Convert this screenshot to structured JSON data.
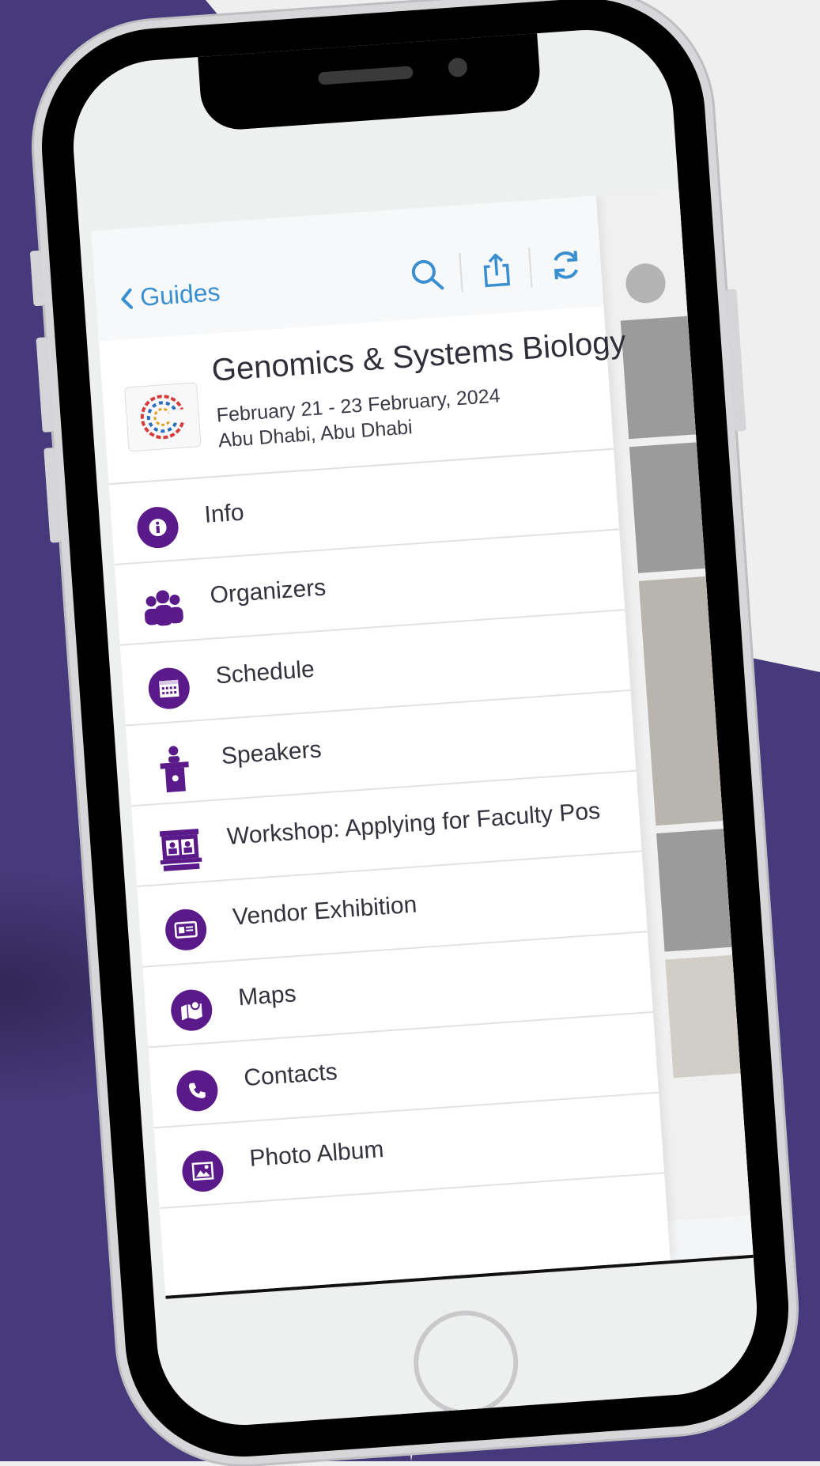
{
  "colors": {
    "background_purple": "#473a7c",
    "icon_purple": "#5a1a8a",
    "link_blue": "#3a8fd0",
    "phone_frame": "#000000"
  },
  "topbar": {
    "back_label": "Guides",
    "icons": [
      "search-icon",
      "share-icon",
      "refresh-icon"
    ]
  },
  "event": {
    "title": "Genomics & Systems Biology",
    "dates": "February 21 - 23 February, 2024",
    "location": "Abu Dhabi, Abu Dhabi"
  },
  "menu": {
    "items": [
      {
        "label": "Info",
        "icon": "info-icon"
      },
      {
        "label": "Organizers",
        "icon": "people-icon"
      },
      {
        "label": "Schedule",
        "icon": "calendar-icon"
      },
      {
        "label": "Speakers",
        "icon": "podium-icon"
      },
      {
        "label": "Workshop: Applying for Faculty Pos",
        "icon": "booth-icon"
      },
      {
        "label": "Vendor Exhibition",
        "icon": "badge-icon"
      },
      {
        "label": "Maps",
        "icon": "map-icon"
      },
      {
        "label": "Contacts",
        "icon": "phone-icon"
      },
      {
        "label": "Photo Album",
        "icon": "photo-icon"
      }
    ]
  }
}
